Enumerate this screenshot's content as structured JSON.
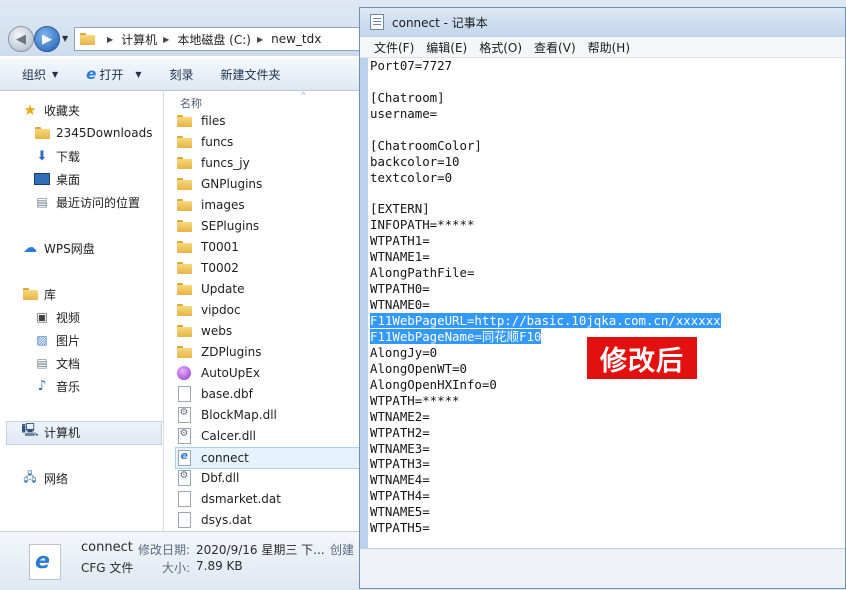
{
  "explorer": {
    "breadcrumb": [
      "计算机",
      "本地磁盘 (C:)",
      "new_tdx"
    ],
    "toolbar": {
      "organize": "组织",
      "open": "打开",
      "burn": "刻录",
      "new_folder": "新建文件夹"
    },
    "nav": {
      "favorites": "收藏夹",
      "fav_items": [
        "2345Downloads",
        "下载",
        "桌面",
        "最近访问的位置"
      ],
      "wps": "WPS网盘",
      "libraries": "库",
      "lib_items": [
        "视频",
        "图片",
        "文档",
        "音乐"
      ],
      "computer": "计算机",
      "network": "网络"
    },
    "files": {
      "column_name": "名称",
      "items": [
        {
          "name": "files",
          "type": "folder"
        },
        {
          "name": "funcs",
          "type": "folder"
        },
        {
          "name": "funcs_jy",
          "type": "folder"
        },
        {
          "name": "GNPlugins",
          "type": "folder"
        },
        {
          "name": "images",
          "type": "folder"
        },
        {
          "name": "SEPlugins",
          "type": "folder"
        },
        {
          "name": "T0001",
          "type": "folder"
        },
        {
          "name": "T0002",
          "type": "folder"
        },
        {
          "name": "Update",
          "type": "folder"
        },
        {
          "name": "vipdoc",
          "type": "folder"
        },
        {
          "name": "webs",
          "type": "folder"
        },
        {
          "name": "ZDPlugins",
          "type": "folder"
        },
        {
          "name": "AutoUpEx",
          "type": "exe"
        },
        {
          "name": "base.dbf",
          "type": "doc"
        },
        {
          "name": "BlockMap.dll",
          "type": "gear"
        },
        {
          "name": "Calcer.dll",
          "type": "gear"
        },
        {
          "name": "connect",
          "type": "ie"
        },
        {
          "name": "Dbf.dll",
          "type": "gear"
        },
        {
          "name": "dsmarket.dat",
          "type": "doc"
        },
        {
          "name": "dsys.dat",
          "type": "doc"
        }
      ]
    },
    "details": {
      "name": "connect",
      "type": "CFG 文件",
      "modified_label": "修改日期:",
      "modified_value": "2020/9/16 星期三 下...",
      "size_label": "大小:",
      "size_value": "7.89 KB",
      "created_label": "创建"
    }
  },
  "notepad": {
    "title": "connect - 记事本",
    "menu": [
      "文件(F)",
      "编辑(E)",
      "格式(O)",
      "查看(V)",
      "帮助(H)"
    ],
    "lines": [
      "Port07=7727",
      "",
      "[Chatroom]",
      "username=",
      "",
      "[ChatroomColor]",
      "backcolor=10",
      "textcolor=0",
      "",
      "[EXTERN]",
      "INFOPATH=*****",
      "WTPATH1=",
      "WTNAME1=",
      "AlongPathFile=",
      "WTPATH0=",
      "WTNAME0=",
      "F11WebPageURL=http://basic.10jqka.com.cn/xxxxxx",
      "F11WebPageName=同花顺F10",
      "AlongJy=0",
      "AlongOpenWT=0",
      "AlongOpenHXInfo=0",
      "WTPATH=*****",
      "WTNAME2=",
      "WTPATH2=",
      "WTNAME3=",
      "WTPATH3=",
      "WTNAME4=",
      "WTPATH4=",
      "WTNAME5=",
      "WTPATH5="
    ],
    "highlighted_lines": [
      16,
      17
    ],
    "annotation": "修改后"
  },
  "colors": {
    "selection": "#3399ff",
    "annotation_bg": "#e31010",
    "titlebar": "#c3d6ec"
  }
}
